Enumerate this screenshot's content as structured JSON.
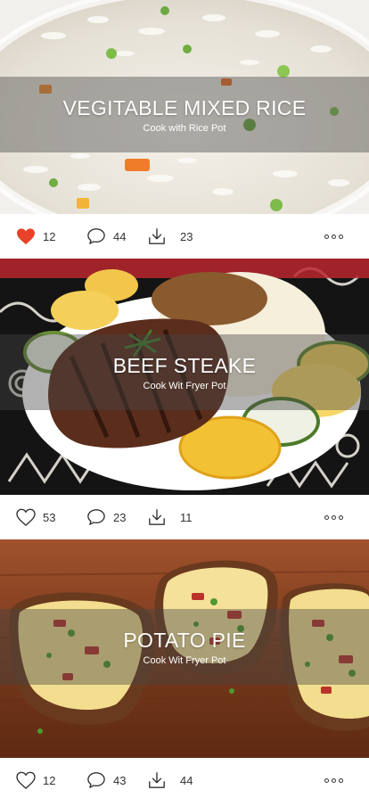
{
  "posts": [
    {
      "title": "VEGITABLE MIXED RICE",
      "subtitle": "Cook with Rice Pot",
      "likes": "12",
      "comments": "44",
      "saves": "23",
      "liked": true
    },
    {
      "title": "BEEF STEAKE",
      "subtitle": "Cook Wit Fryer Pot",
      "likes": "53",
      "comments": "23",
      "saves": "11",
      "liked": false
    },
    {
      "title": "POTATO PIE",
      "subtitle": "Cook Wit Fryer Pot",
      "likes": "12",
      "comments": "43",
      "saves": "44",
      "liked": false
    }
  ],
  "icons": {
    "like": "heart-icon",
    "comment": "comment-icon",
    "save": "download-icon",
    "more": "more-icon"
  },
  "colors": {
    "liked_heart": "#e8432a",
    "icon": "#333333",
    "caption_text": "#ffffff"
  }
}
